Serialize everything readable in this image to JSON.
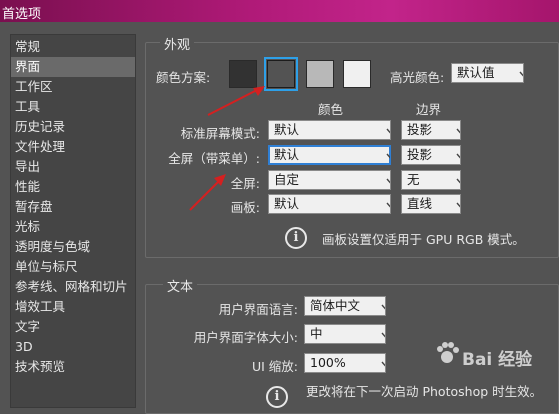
{
  "window": {
    "title": "首选项"
  },
  "sidebar": {
    "items": [
      {
        "label": "常规",
        "active": false
      },
      {
        "label": "界面",
        "active": true
      },
      {
        "label": "工作区",
        "active": false
      },
      {
        "label": "工具",
        "active": false
      },
      {
        "label": "历史记录",
        "active": false
      },
      {
        "label": "文件处理",
        "active": false
      },
      {
        "label": "导出",
        "active": false
      },
      {
        "label": "性能",
        "active": false
      },
      {
        "label": "暂存盘",
        "active": false
      },
      {
        "label": "光标",
        "active": false
      },
      {
        "label": "透明度与色域",
        "active": false
      },
      {
        "label": "单位与标尺",
        "active": false
      },
      {
        "label": "参考线、网格和切片",
        "active": false
      },
      {
        "label": "增效工具",
        "active": false
      },
      {
        "label": "文字",
        "active": false
      },
      {
        "label": "3D",
        "active": false
      },
      {
        "label": "技术预览",
        "active": false
      }
    ]
  },
  "appearance": {
    "section_title": "外观",
    "color_scheme_label": "颜色方案:",
    "swatches": [
      {
        "color": "#323232",
        "selected": false
      },
      {
        "color": "#535353",
        "selected": true
      },
      {
        "color": "#b8b8b8",
        "selected": false
      },
      {
        "color": "#f0f0f0",
        "selected": false
      }
    ],
    "highlight_label": "高光颜色:",
    "highlight_value": "默认值",
    "col_color": "颜色",
    "col_border": "边界",
    "rows": [
      {
        "label": "标准屏幕模式:",
        "color": "默认",
        "border": "投影"
      },
      {
        "label": "全屏（带菜单）:",
        "color": "默认",
        "border": "投影"
      },
      {
        "label": "全屏:",
        "color": "自定",
        "border": "无"
      },
      {
        "label": "画板:",
        "color": "默认",
        "border": "直线"
      }
    ],
    "info_text": "画板设置仅适用于 GPU RGB 模式。"
  },
  "text": {
    "section_title": "文本",
    "language_label": "用户界面语言:",
    "language_value": "简体中文",
    "font_size_label": "用户界面字体大小:",
    "font_size_value": "中",
    "ui_scale_label": "UI 缩放:",
    "ui_scale_value": "100%",
    "restart_note": "更改将在下一次启动 Photoshop 时生效。"
  },
  "watermark": {
    "text": "Bai 经验"
  },
  "colors": {
    "accent": "#2ea0e8",
    "arrow": "#d42020",
    "panel": "#535353"
  }
}
